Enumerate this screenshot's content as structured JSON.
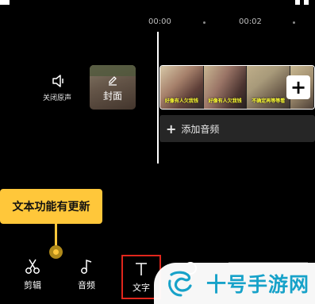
{
  "timeline": {
    "time_start": "00:00",
    "time_mark": "00:02"
  },
  "mute": {
    "label": "关闭原声",
    "icon": "speaker-icon"
  },
  "cover": {
    "label": "封面",
    "icon": "pencil-icon"
  },
  "clips": {
    "captions": [
      "好像有人欠我钱",
      "好像有人欠我钱",
      "不确定再等等看"
    ],
    "add_icon": "plus-icon"
  },
  "audio": {
    "add_label": "添加音频",
    "icon": "plus-icon"
  },
  "tooltip": {
    "text": "文本功能有更新"
  },
  "toolbar": {
    "items": [
      {
        "label": "剪辑",
        "icon": "scissors-icon"
      },
      {
        "label": "音频",
        "icon": "music-note-icon"
      },
      {
        "label": "文字",
        "icon": "text-icon"
      }
    ]
  },
  "watermark": {
    "text": "十号手游网"
  },
  "colors": {
    "accent_yellow": "#ffc73a",
    "highlight_red": "#e0261c",
    "watermark_blue": "#17a2c9"
  }
}
